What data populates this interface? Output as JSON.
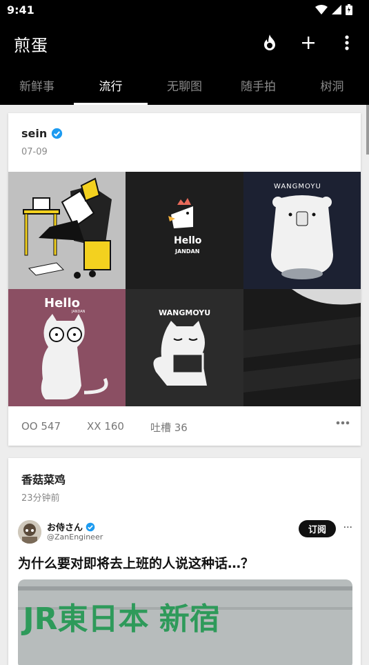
{
  "status": {
    "time": "9:41"
  },
  "appbar": {
    "title": "煎蛋",
    "icons": [
      "flame-icon",
      "plus-icon",
      "more-vert-icon"
    ]
  },
  "tabs": [
    {
      "label": "新鲜事",
      "active": false
    },
    {
      "label": "流行",
      "active": true
    },
    {
      "label": "无聊图",
      "active": false
    },
    {
      "label": "随手拍",
      "active": false
    },
    {
      "label": "树洞",
      "active": false
    }
  ],
  "posts": [
    {
      "author": "sein",
      "verified": true,
      "date": "07-09",
      "images": [
        {
          "text": ""
        },
        {
          "text": "Hello JANDAN"
        },
        {
          "text": "WANGMOYU"
        },
        {
          "text": "Hello JANDAN"
        },
        {
          "text": "WANGMOYU"
        },
        {
          "text": ""
        }
      ],
      "oo": "OO 547",
      "xx": "XX 160",
      "comments": "吐槽 36"
    },
    {
      "author": "香菇菜鸡",
      "date": "23分钟前",
      "quote": {
        "name": "お侍さん",
        "handle": "@ZanEngineer",
        "subscribe": "订阅",
        "more": "···",
        "text": "为什么要对即将去上班的人说这种话…？",
        "image_text": "JR東日本 新宿"
      }
    }
  ],
  "colors": {
    "background": "#ededed",
    "bar": "#000000",
    "verified": "#1d9bf0"
  }
}
